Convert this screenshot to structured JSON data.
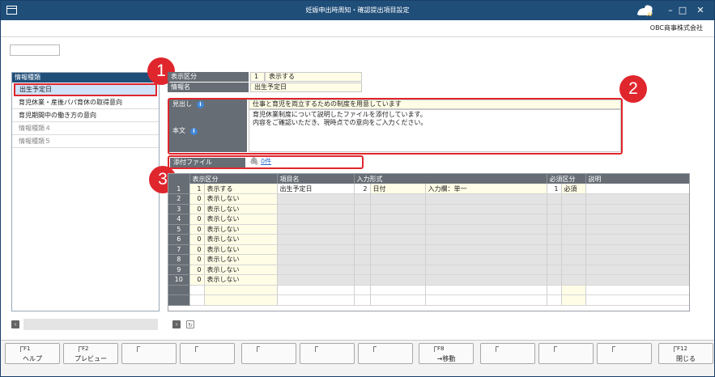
{
  "window": {
    "title": "妊娠申出時周知・確認提出項目設定",
    "company": "OBC商事株式会社"
  },
  "left_panel": {
    "header": "情報種類",
    "items": [
      {
        "label": "出生予定日",
        "selected": true
      },
      {
        "label": "育児休業・産後パパ育休の取得意向",
        "selected": false
      },
      {
        "label": "育児期間中の働き方の意向",
        "selected": false
      },
      {
        "label": "情報種類４",
        "dim": true
      },
      {
        "label": "情報種類５",
        "dim": true
      }
    ]
  },
  "detail": {
    "display_label": "表示区分",
    "display_code": "1",
    "display_value": "表示する",
    "name_label": "情報名",
    "name_value": "出生予定日",
    "heading_label": "見出し",
    "heading_value": "仕事と育児を両立するための制度を用意しています",
    "body_label": "本文",
    "body_lines": [
      "育児休業制度について説明したファイルを添付しています。",
      "内容をご確認いただき、現時点での意向をご入力ください。"
    ],
    "attachment_label": "添付ファイル",
    "attachment_value": "0件"
  },
  "badges": [
    "1",
    "2",
    "3"
  ],
  "grid": {
    "headers": [
      "表示区分",
      "項目名",
      "入力形式",
      "必須区分",
      "説明"
    ],
    "rows": [
      {
        "no": "1",
        "disp_code": "1",
        "disp": "表示する",
        "item": "出生予定日",
        "fmt_code": "2",
        "fmt": "日付",
        "fmt2": "入力欄：単一",
        "req_code": "1",
        "req": "必須"
      },
      {
        "no": "2",
        "disp_code": "0",
        "disp": "表示しない"
      },
      {
        "no": "3",
        "disp_code": "0",
        "disp": "表示しない"
      },
      {
        "no": "4",
        "disp_code": "0",
        "disp": "表示しない"
      },
      {
        "no": "5",
        "disp_code": "0",
        "disp": "表示しない"
      },
      {
        "no": "6",
        "disp_code": "0",
        "disp": "表示しない"
      },
      {
        "no": "7",
        "disp_code": "0",
        "disp": "表示しない"
      },
      {
        "no": "8",
        "disp_code": "0",
        "disp": "表示しない"
      },
      {
        "no": "9",
        "disp_code": "0",
        "disp": "表示しない"
      },
      {
        "no": "10",
        "disp_code": "0",
        "disp": "表示しない"
      }
    ]
  },
  "fkeys": [
    {
      "key": "F1",
      "label": "ヘルプ"
    },
    {
      "key": "F2",
      "label": "プレビュー"
    },
    {
      "key": "",
      "label": ""
    },
    {
      "key": "",
      "label": ""
    },
    {
      "key": "",
      "label": ""
    },
    {
      "key": "",
      "label": ""
    },
    {
      "key": "",
      "label": ""
    },
    {
      "key": "F8",
      "label": "→移動"
    },
    {
      "key": "",
      "label": ""
    },
    {
      "key": "",
      "label": ""
    },
    {
      "key": "",
      "label": ""
    },
    {
      "key": "F12",
      "label": "閉じる"
    }
  ],
  "colors": {
    "titlebar": "#1f4e79",
    "label_bg": "#666d75",
    "input_bg": "#fffde6",
    "highlight": "#e0262d",
    "link": "#2a6bd1"
  }
}
